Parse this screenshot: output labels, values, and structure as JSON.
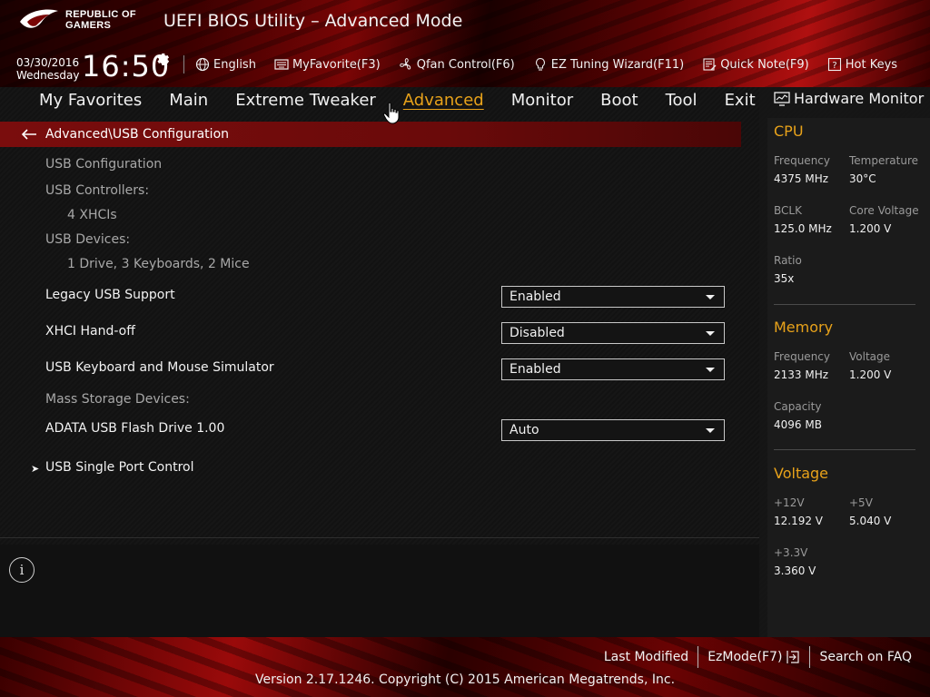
{
  "header": {
    "logo_line1": "REPUBLIC OF",
    "logo_line2": "GAMERS",
    "title": "UEFI BIOS Utility – Advanced Mode",
    "date": "03/30/2016",
    "weekday": "Wednesday",
    "time": "16:50"
  },
  "toolbar": {
    "language": "English",
    "myfavorite": "MyFavorite(F3)",
    "qfan": "Qfan Control(F6)",
    "ez_tuning": "EZ Tuning Wizard(F11)",
    "quick_note": "Quick Note(F9)",
    "hot_keys": "Hot Keys"
  },
  "tabs": {
    "my_favorites": "My Favorites",
    "main": "Main",
    "extreme_tweaker": "Extreme Tweaker",
    "advanced": "Advanced",
    "monitor": "Monitor",
    "boot": "Boot",
    "tool": "Tool",
    "exit": "Exit",
    "active": "Advanced"
  },
  "breadcrumb": "Advanced\\USB Configuration",
  "content": {
    "usb_configuration": "USB Configuration",
    "usb_controllers_label": "USB Controllers:",
    "usb_controllers_value": "4 XHCIs",
    "usb_devices_label": "USB Devices:",
    "usb_devices_value": "1 Drive, 3 Keyboards, 2 Mice",
    "legacy_usb_label": "Legacy USB Support",
    "legacy_usb_value": "Enabled",
    "xhci_label": "XHCI Hand-off",
    "xhci_value": "Disabled",
    "kbm_sim_label": "USB Keyboard and Mouse Simulator",
    "kbm_sim_value": "Enabled",
    "mass_storage_label": "Mass Storage Devices:",
    "adata_label": "ADATA USB Flash Drive 1.00",
    "adata_value": "Auto",
    "single_port_label": "USB Single Port Control",
    "submenu_arrow": "➤"
  },
  "help": {
    "info_glyph": "i"
  },
  "hw_monitor": {
    "title": "Hardware Monitor",
    "cpu": {
      "heading": "CPU",
      "frequency_label": "Frequency",
      "frequency_value": "4375 MHz",
      "temperature_label": "Temperature",
      "temperature_value": "30°C",
      "bclk_label": "BCLK",
      "bclk_value": "125.0 MHz",
      "core_voltage_label": "Core Voltage",
      "core_voltage_value": "1.200 V",
      "ratio_label": "Ratio",
      "ratio_value": "35x"
    },
    "memory": {
      "heading": "Memory",
      "frequency_label": "Frequency",
      "frequency_value": "2133 MHz",
      "voltage_label": "Voltage",
      "voltage_value": "1.200 V",
      "capacity_label": "Capacity",
      "capacity_value": "4096 MB"
    },
    "voltage": {
      "heading": "Voltage",
      "v12_label": "+12V",
      "v12_value": "12.192 V",
      "v5_label": "+5V",
      "v5_value": "5.040 V",
      "v33_label": "+3.3V",
      "v33_value": "3.360 V"
    }
  },
  "footer": {
    "last_modified": "Last Modified",
    "ezmode": "EzMode(F7)",
    "search_faq": "Search on FAQ",
    "copyright": "Version 2.17.1246. Copyright (C) 2015 American Megatrends, Inc."
  },
  "colors": {
    "accent": "#e8a21a",
    "brand_red": "#7a0d0d",
    "text": "#f2f2f2",
    "dim_text": "#a8a8a8"
  },
  "icons": {
    "logo": "rog-eye-logo",
    "gear": "gear-icon",
    "language": "globe-icon",
    "myfavorite": "keyboard-icon",
    "qfan": "fan-icon",
    "ez_tuning": "lightbulb-icon",
    "quick_note": "note-icon",
    "hot_keys": "question-icon",
    "back": "arrow-left-icon",
    "hw_monitor": "monitor-icon",
    "ezmode": "exit-arrow-icon",
    "info": "info-icon",
    "cursor": "hand-cursor-icon"
  }
}
